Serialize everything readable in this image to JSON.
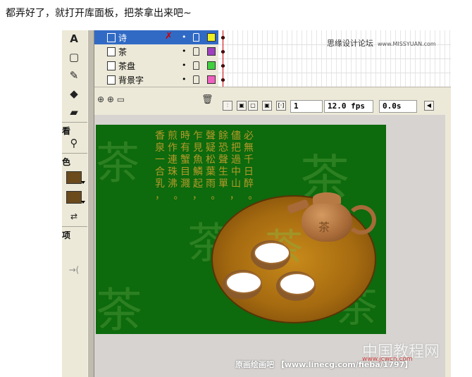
{
  "caption": "都弄好了，就打开库面板，把茶拿出来吧~",
  "tools": {
    "view_label": "看",
    "color_label": "色",
    "options_label": "项"
  },
  "layers": [
    {
      "name": "诗",
      "selected": true,
      "color": "#f0f020"
    },
    {
      "name": "茶",
      "selected": false,
      "color": "#a040c0"
    },
    {
      "name": "茶盘",
      "selected": false,
      "color": "#40d040"
    },
    {
      "name": "背景字",
      "selected": false,
      "color": "#f060c0"
    }
  ],
  "timeline": {
    "frame": "1",
    "fps": "12.0 fps",
    "time": "0.0s"
  },
  "watermarks": {
    "forum": "思缘设计论坛",
    "forum_url": "www.MISSYUAN.com",
    "footer": "原画绘画吧 【www.linecg.com/fieba/1797】",
    "logo": "中国教程网",
    "logo_url": "www.jcwcn.com"
  },
  "stage": {
    "big_char": "茶",
    "poem_lines": [
      "香煎時乍聲餘儘必",
      "泉作有見疑恐把無",
      "一連蟹魚松聲過千",
      "合珠目鱗葉生中日",
      "乳沸濺起雨單山醉"
    ],
    "poem_dots": "， 。 ， 。 ， 。"
  }
}
